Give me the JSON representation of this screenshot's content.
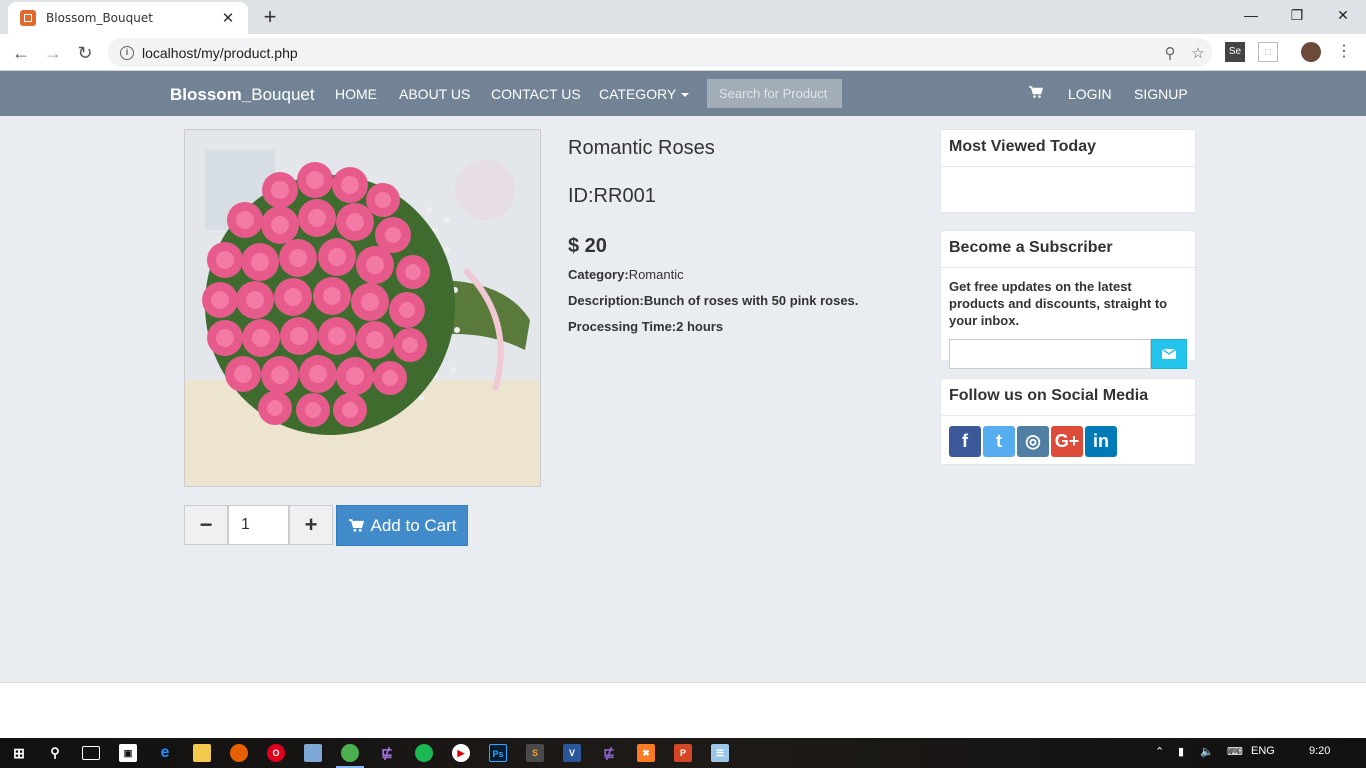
{
  "browser": {
    "tab_title": "Blossom_Bouquet",
    "url": "localhost/my/product.php",
    "new_tab": "+",
    "close": "✕"
  },
  "navbar": {
    "brand_bold": "Blossom_",
    "brand_rest": "Bouquet",
    "links": [
      "HOME",
      "ABOUT US",
      "CONTACT US",
      "CATEGORY"
    ],
    "search_placeholder": "Search for Product",
    "login": "LOGIN",
    "signup": "SIGNUP"
  },
  "product": {
    "name": "Romantic Roses",
    "id": "ID:RR001",
    "price": "$ 20",
    "category_label": "Category:",
    "category": "Romantic",
    "description_label": "Description:",
    "description": "Bunch of roses with 50 pink roses.",
    "processing_label": "Processing Time:",
    "processing": "2 hours",
    "quantity": "1",
    "minus": "−",
    "plus": "+",
    "add_to_cart": "Add to Cart"
  },
  "sidebar": {
    "most_viewed_title": "Most Viewed Today",
    "subscriber_title": "Become a Subscriber",
    "subscriber_text": "Get free updates on the latest products and discounts, straight to your inbox.",
    "social_title": "Follow us on Social Media",
    "social": [
      {
        "name": "facebook",
        "glyph": "f",
        "color": "#3b5998"
      },
      {
        "name": "twitter",
        "glyph": "t",
        "color": "#55acee"
      },
      {
        "name": "instagram",
        "glyph": "◎",
        "color": "#517fa4"
      },
      {
        "name": "google-plus",
        "glyph": "G+",
        "color": "#dd4b39"
      },
      {
        "name": "linkedin",
        "glyph": "in",
        "color": "#007bb5"
      }
    ]
  },
  "taskbar": {
    "lang": "ENG",
    "time": "9:20"
  }
}
